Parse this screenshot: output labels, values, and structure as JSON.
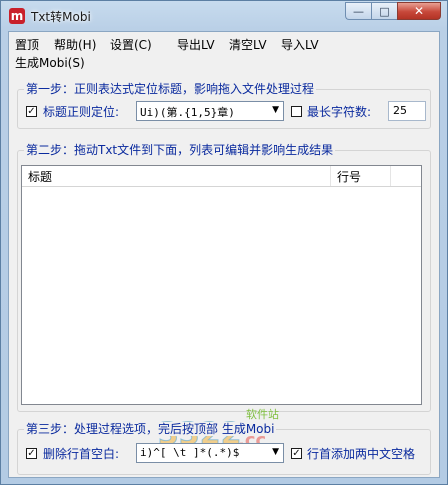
{
  "window": {
    "icon_letter": "m",
    "title": "Txt转Mobi",
    "controls": {
      "minimize": "—",
      "maximize": "□",
      "close": "✕"
    }
  },
  "menu": {
    "items": [
      "置顶",
      "帮助(H)",
      "设置(C)",
      "导出LV",
      "清空LV",
      "导入LV",
      "生成Mobi(S)"
    ]
  },
  "step1": {
    "label": "第一步：正则表达式定位标题，影响拖入文件处理过程",
    "title_regex_label": "标题正则定位:",
    "title_regex_checked": true,
    "title_regex_value": "Ui)(第.{1,5}章)",
    "max_chars_label": "最长字符数:",
    "max_chars_checked": false,
    "max_chars_value": "25"
  },
  "step2": {
    "label": "第二步：拖动Txt文件到下面，列表可编辑并影响生成结果",
    "columns": [
      "标题",
      "行号"
    ]
  },
  "step3": {
    "label": "第三步：处理过程选项，完后按顶部 生成Mobi",
    "trim_label": "删除行首空白:",
    "trim_checked": true,
    "trim_value": "i)^[ \\t  ]*(.*)$",
    "indent_label": "行首添加两中文空格",
    "indent_checked": true
  },
  "watermark": {
    "brand": "3322",
    "suffix": ".cc",
    "site_label": "软件站"
  }
}
